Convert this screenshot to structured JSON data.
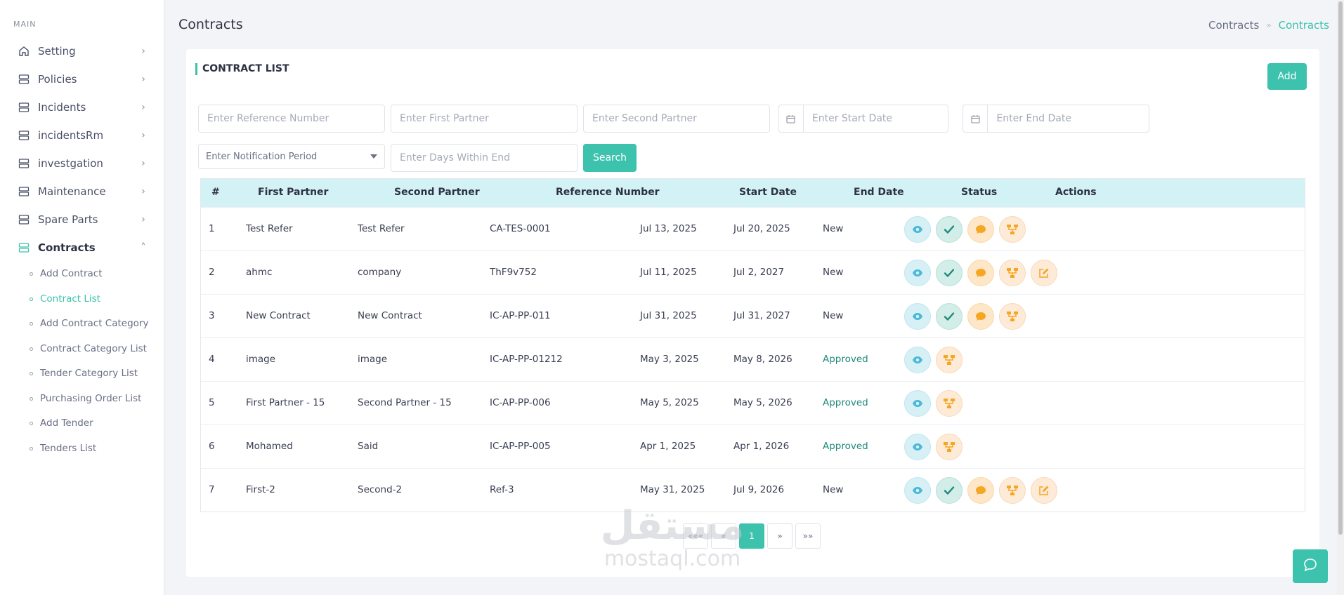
{
  "sidebar": {
    "section": "MAIN",
    "items": [
      {
        "label": "Setting"
      },
      {
        "label": "Policies"
      },
      {
        "label": "Incidents"
      },
      {
        "label": "incidentsRm"
      },
      {
        "label": "investgation"
      },
      {
        "label": "Maintenance"
      },
      {
        "label": "Spare Parts"
      },
      {
        "label": "Contracts"
      }
    ],
    "sub_items": [
      {
        "label": "Add Contract"
      },
      {
        "label": "Contract List"
      },
      {
        "label": "Add Contract Category"
      },
      {
        "label": "Contract Category List"
      },
      {
        "label": "Tender Category List"
      },
      {
        "label": "Purchasing Order List"
      },
      {
        "label": "Add Tender"
      },
      {
        "label": "Tenders List"
      }
    ]
  },
  "header": {
    "title": "Contracts",
    "breadcrumb": [
      "Contracts",
      "Contracts"
    ],
    "breadcrumb_sep": "»"
  },
  "card": {
    "title": "CONTRACT LIST",
    "add_label": "Add",
    "search_label": "Search"
  },
  "filters": {
    "reference": {
      "placeholder": "Enter Reference Number",
      "value": ""
    },
    "first_partner": {
      "placeholder": "Enter First Partner",
      "value": ""
    },
    "second_partner": {
      "placeholder": "Enter Second Partner",
      "value": ""
    },
    "start_date": {
      "placeholder": "Enter Start Date",
      "value": ""
    },
    "end_date": {
      "placeholder": "Enter End Date",
      "value": ""
    },
    "notification_period": {
      "selected": "Enter Notification Period"
    },
    "days_within_end": {
      "placeholder": "Enter Days Within End",
      "value": ""
    }
  },
  "table": {
    "columns": [
      "#",
      "First Partner",
      "Second Partner",
      "Reference Number",
      "Start Date",
      "End Date",
      "Status",
      "Actions"
    ],
    "rows": [
      {
        "n": "1",
        "first": "Test Refer",
        "second": "Test Refer",
        "ref": "CA-TES-0001",
        "start": "Jul 13, 2025",
        "end": "Jul 20, 2025",
        "status": "New"
      },
      {
        "n": "2",
        "first": "ahmc",
        "second": "company",
        "ref": "ThF9v752",
        "start": "Jul 11, 2025",
        "end": "Jul 2, 2027",
        "status": "New"
      },
      {
        "n": "3",
        "first": "New Contract",
        "second": "New Contract",
        "ref": "IC-AP-PP-011",
        "start": "Jul 31, 2025",
        "end": "Jul 31, 2027",
        "status": "New"
      },
      {
        "n": "4",
        "first": "image",
        "second": "image",
        "ref": "IC-AP-PP-01212",
        "start": "May 3, 2025",
        "end": "May 8, 2026",
        "status": "Approved"
      },
      {
        "n": "5",
        "first": "First Partner - 15",
        "second": "Second Partner - 15",
        "ref": "IC-AP-PP-006",
        "start": "May 5, 2025",
        "end": "May 5, 2026",
        "status": "Approved"
      },
      {
        "n": "6",
        "first": "Mohamed",
        "second": "Said",
        "ref": "IC-AP-PP-005",
        "start": "Apr 1, 2025",
        "end": "Apr 1, 2026",
        "status": "Approved"
      },
      {
        "n": "7",
        "first": "First-2",
        "second": "Second-2",
        "ref": "Ref-3",
        "start": "May 31, 2025",
        "end": "Jul 9, 2026",
        "status": "New"
      }
    ]
  },
  "pagination": {
    "first": "«««",
    "prev": "«",
    "current": "1",
    "next": "»",
    "last": "»»"
  },
  "watermark": {
    "arabic": "مستقل",
    "latin": "mostaql.com"
  },
  "colors": {
    "accent": "#3cc2ad",
    "header_bg": "#d3f2f6",
    "approved": "#1f8a7a"
  }
}
